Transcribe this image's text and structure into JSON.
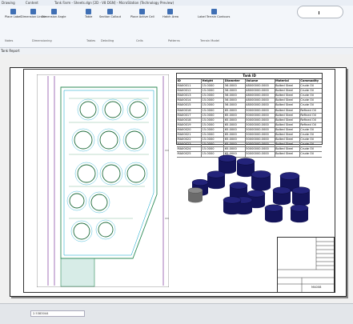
{
  "window": {
    "title": "Tank Farm - Sheets.dgn [2D - V8 DGN] - MicroStation (Technology Preview)",
    "menu": [
      "Drawing",
      "Content"
    ]
  },
  "ribbon": {
    "tools": [
      {
        "label": "Place Label"
      },
      {
        "label": "Dimension Linear"
      },
      {
        "label": "Dimension Angle"
      },
      {
        "label": "Table"
      },
      {
        "label": "Section Callout"
      },
      {
        "label": "Place Active Cell"
      },
      {
        "label": "Hatch Area"
      },
      {
        "label": "Label Terrain Contours"
      }
    ],
    "groups": [
      "Notes",
      "Dimensioning",
      "Tables",
      "Detailing",
      "Cells",
      "Patterns",
      "Terrain Model"
    ]
  },
  "tab": {
    "label": "Tank Report"
  },
  "table": {
    "title": "Tank ID",
    "headers": [
      "ID",
      "Height",
      "Diameter",
      "Volume",
      "Material",
      "Commodity"
    ],
    "rows": [
      [
        "MA00011",
        "15.0000",
        "56.0000",
        "48000000.0000",
        "Bolted Steel",
        "Crude Oil"
      ],
      [
        "MA00012",
        "15.0000",
        "56.0000",
        "48000000.0000",
        "Bolted Steel",
        "Crude Oil"
      ],
      [
        "MA00013",
        "15.0000",
        "56.0000",
        "48000000.0000",
        "Bolted Steel",
        "Crude Oil"
      ],
      [
        "MA00014",
        "15.0000",
        "56.0000",
        "48000000.0000",
        "Bolted Steel",
        "Crude Oil"
      ],
      [
        "MA00015",
        "15.0000",
        "56.0000",
        "48000000.0000",
        "Bolted Steel",
        "Crude Oil"
      ],
      [
        "MA00016",
        "15.0000",
        "65.0000",
        "50000000.0000",
        "Bolted Steel",
        "Refined Oil"
      ],
      [
        "MA00017",
        "15.0000",
        "65.0000",
        "50000000.0000",
        "Bolted Steel",
        "Refined Oil"
      ],
      [
        "MA00018",
        "15.0000",
        "65.0000",
        "50000000.0000",
        "Bolted Steel",
        "Refined Oil"
      ],
      [
        "MA00019",
        "15.0000",
        "65.0000",
        "50000000.0000",
        "Bolted Steel",
        "Refined Oil"
      ],
      [
        "MA00020",
        "15.0000",
        "65.0000",
        "50000000.0000",
        "Bolted Steel",
        "Crude Oil"
      ],
      [
        "MA00021",
        "15.0000",
        "65.0000",
        "50000000.0000",
        "Bolted Steel",
        "Crude Oil"
      ],
      [
        "MA00022",
        "15.0000",
        "65.0000",
        "50000000.0000",
        "Bolted Steel",
        "Crude Oil"
      ],
      [
        "MA00023",
        "15.0000",
        "65.0000",
        "50000000.0000",
        "Bolted Steel",
        "Crude Oil"
      ],
      [
        "MA00024",
        "15.0000",
        "65.0000",
        "50000000.0000",
        "Bolted Steel",
        "Crude Oil"
      ],
      [
        "MA00025",
        "15.0000",
        "65.0000",
        "50000000.0000",
        "Bolted Steel",
        "Crude Oil"
      ]
    ]
  },
  "titleblock": {
    "text": "MA008"
  },
  "status": {
    "field": "2.5383044"
  },
  "colors": {
    "tank3d": "#14145a",
    "tank3d_grey": "#6b6b6b",
    "plan_green": "#2e8b57",
    "plan_cyan": "#00a0c8",
    "plan_purple": "#7e3c9e"
  }
}
